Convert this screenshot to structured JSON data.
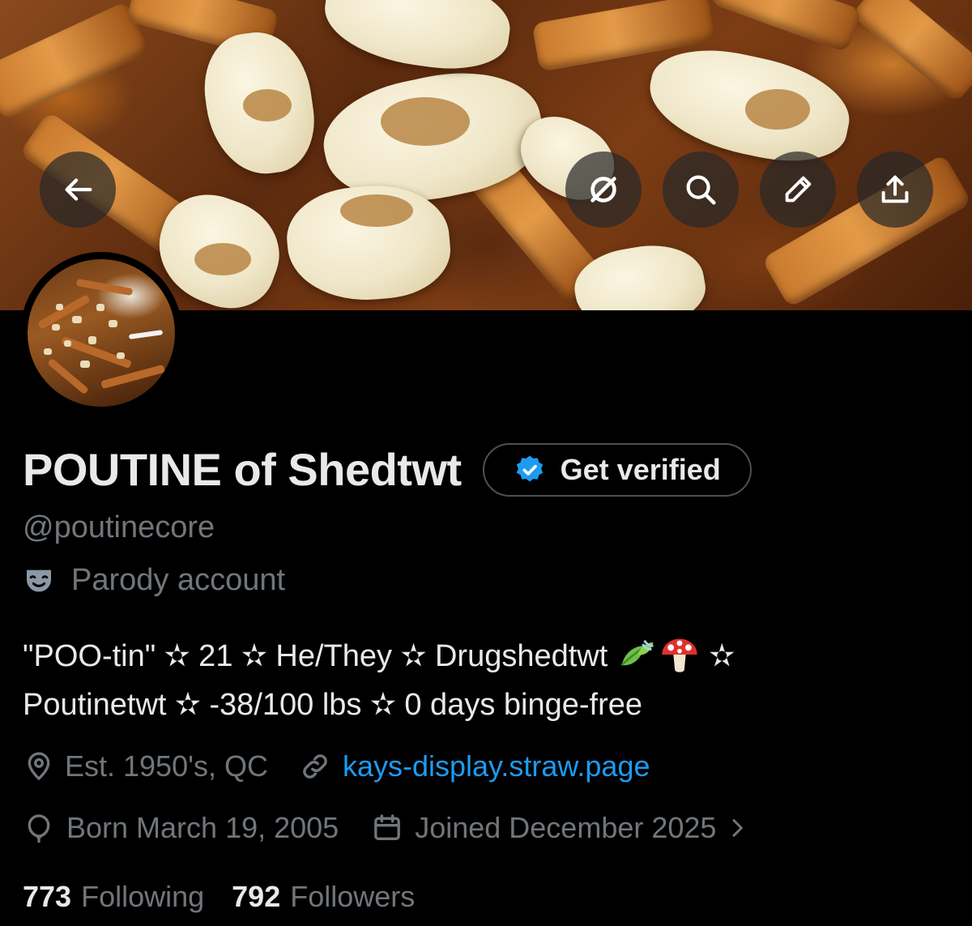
{
  "banner": {
    "back_icon": "arrow-left-icon",
    "actions": [
      {
        "icon": "grok-icon"
      },
      {
        "icon": "search-icon"
      },
      {
        "icon": "pencil-icon"
      },
      {
        "icon": "share-icon"
      }
    ]
  },
  "profile": {
    "display_name": "POUTINE of Shedtwt",
    "verify_label": "Get verified",
    "handle": "@poutinecore",
    "parody_label": "Parody account",
    "bio_line1": "\"POO-tin\" ✫ 21 ✫ He/They ✫ Drugshedtwt ",
    "bio_line1_end": " ✫",
    "bio_line2": "Poutinetwt ✫ -38/100 lbs ✫ 0 days binge-free",
    "location": "Est. 1950's, QC",
    "website": "kays-display.straw.page",
    "birthday": "Born March 19, 2005",
    "joined": "Joined December 2025",
    "following_count": "773",
    "following_label": "Following",
    "followers_count": "792",
    "followers_label": "Followers"
  },
  "colors": {
    "background": "#000000",
    "primary_text": "#e7e9ea",
    "secondary_text": "#71767b",
    "link": "#1d9bf0",
    "verified_badge": "#1d9bf0"
  }
}
